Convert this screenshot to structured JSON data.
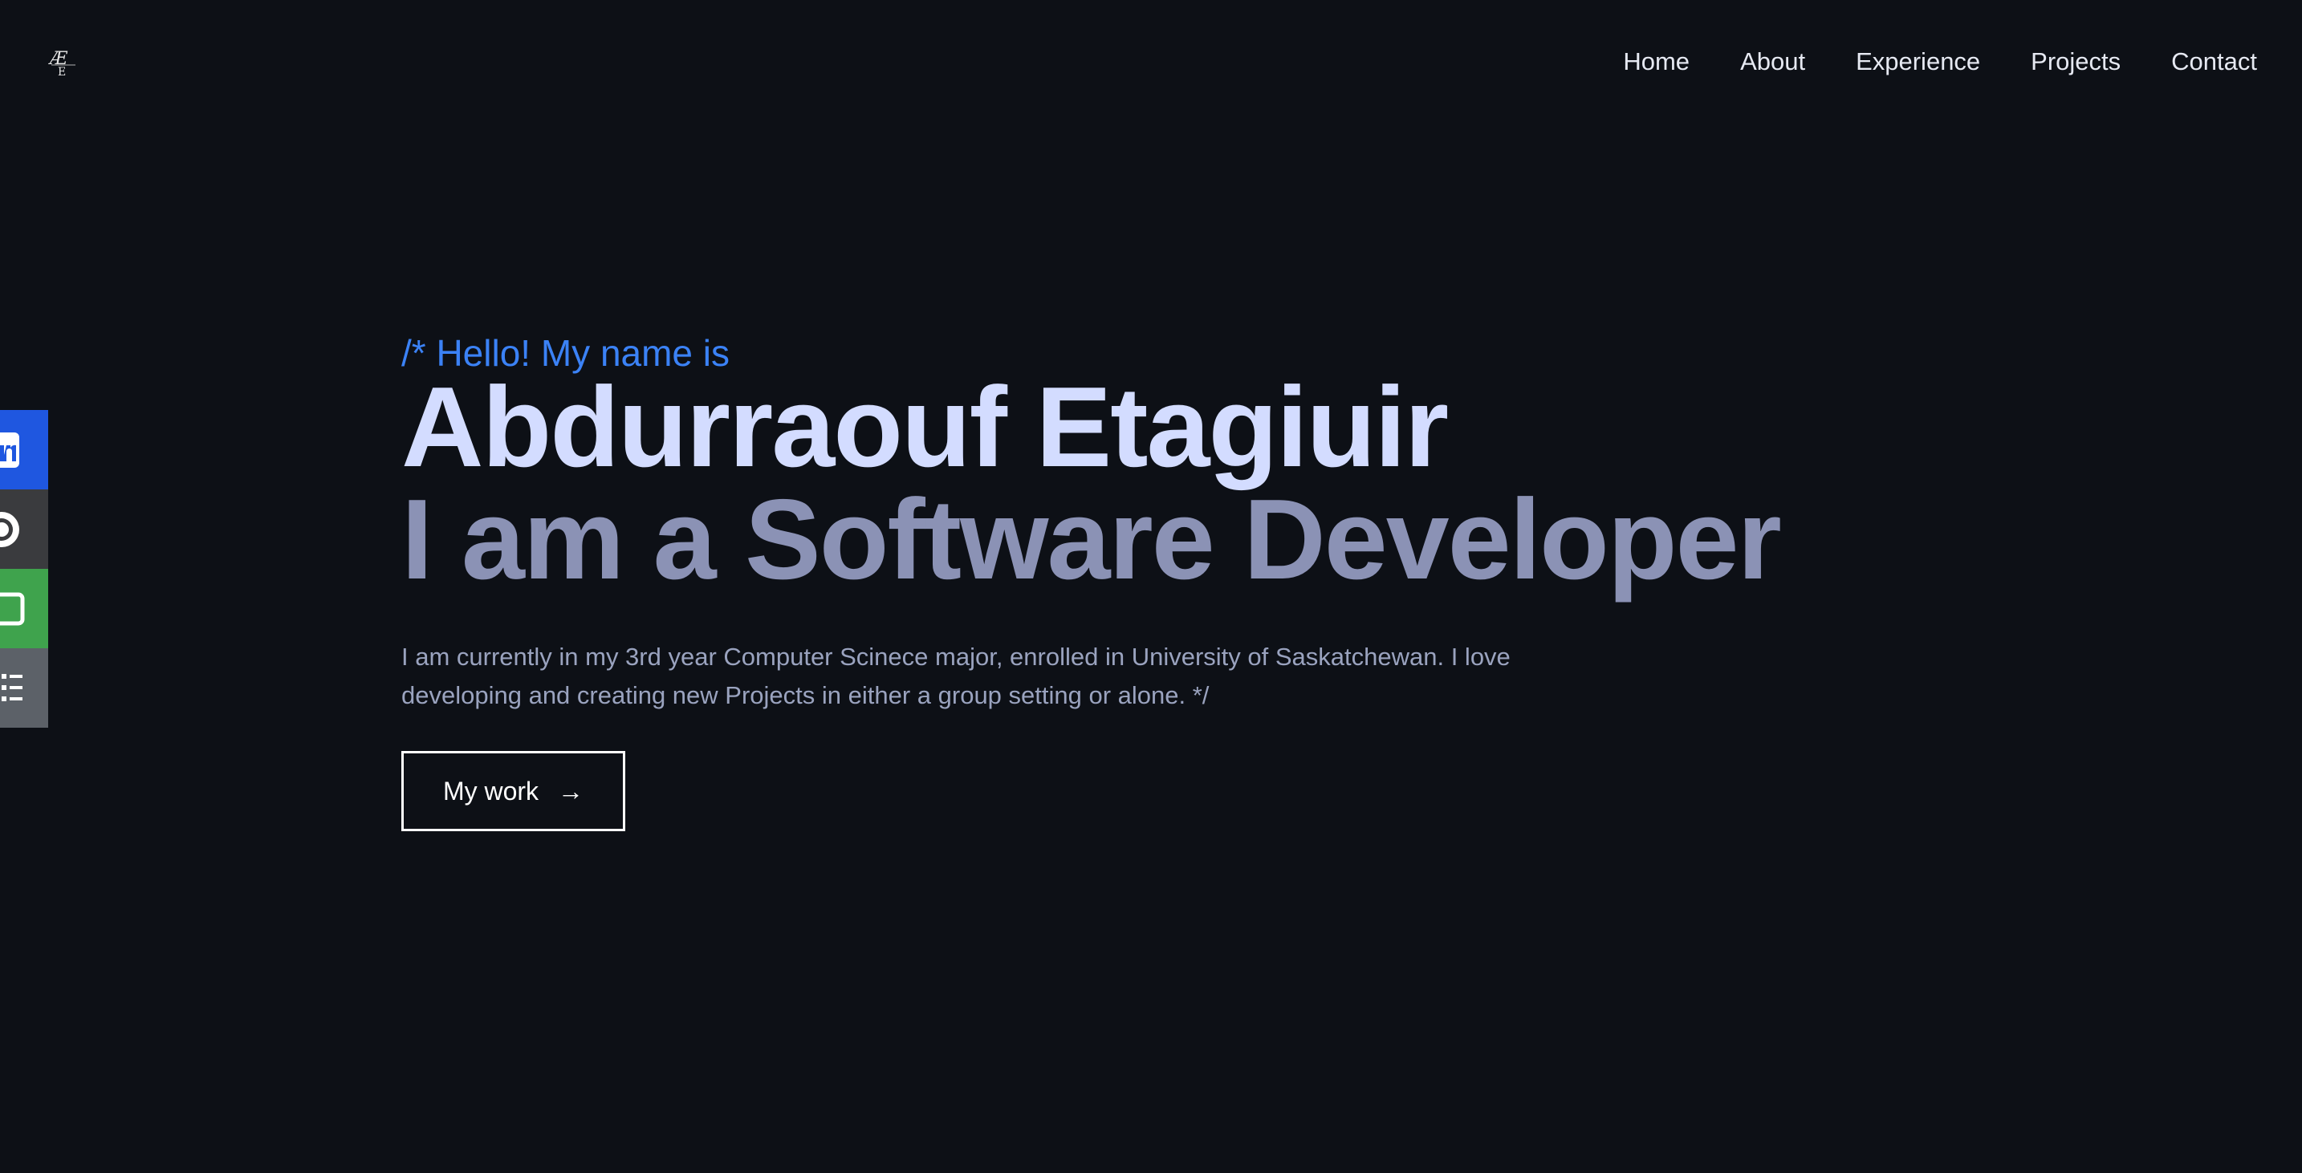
{
  "header": {
    "logo_icon": "ae-monogram-logo",
    "nav": [
      {
        "label": "Home"
      },
      {
        "label": "About"
      },
      {
        "label": "Experience"
      },
      {
        "label": "Projects"
      },
      {
        "label": "Contact"
      }
    ]
  },
  "social": [
    {
      "icon": "linkedin-icon",
      "color": "#1f57e0"
    },
    {
      "icon": "github-icon",
      "color": "#3a3b3e"
    },
    {
      "icon": "email-icon",
      "color": "#3fa34d"
    },
    {
      "icon": "resume-icon",
      "color": "#5c6168"
    }
  ],
  "hero": {
    "greeting": "/* Hello! My name is",
    "name": "Abdurraouf Etagiuir",
    "role": "I am a Software Developer",
    "bio": "I am currently in my 3rd year Computer Scinece major, enrolled in University of Saskatchewan. I love developing and creating new Projects in either a group setting or alone. */",
    "cta_label": "My work",
    "cta_icon": "arrow-right-icon"
  },
  "colors": {
    "background": "#0d1016",
    "accent": "#3b82f6",
    "name": "#d3dcff",
    "role": "#8b92b5",
    "bio": "#9aa3bf"
  }
}
